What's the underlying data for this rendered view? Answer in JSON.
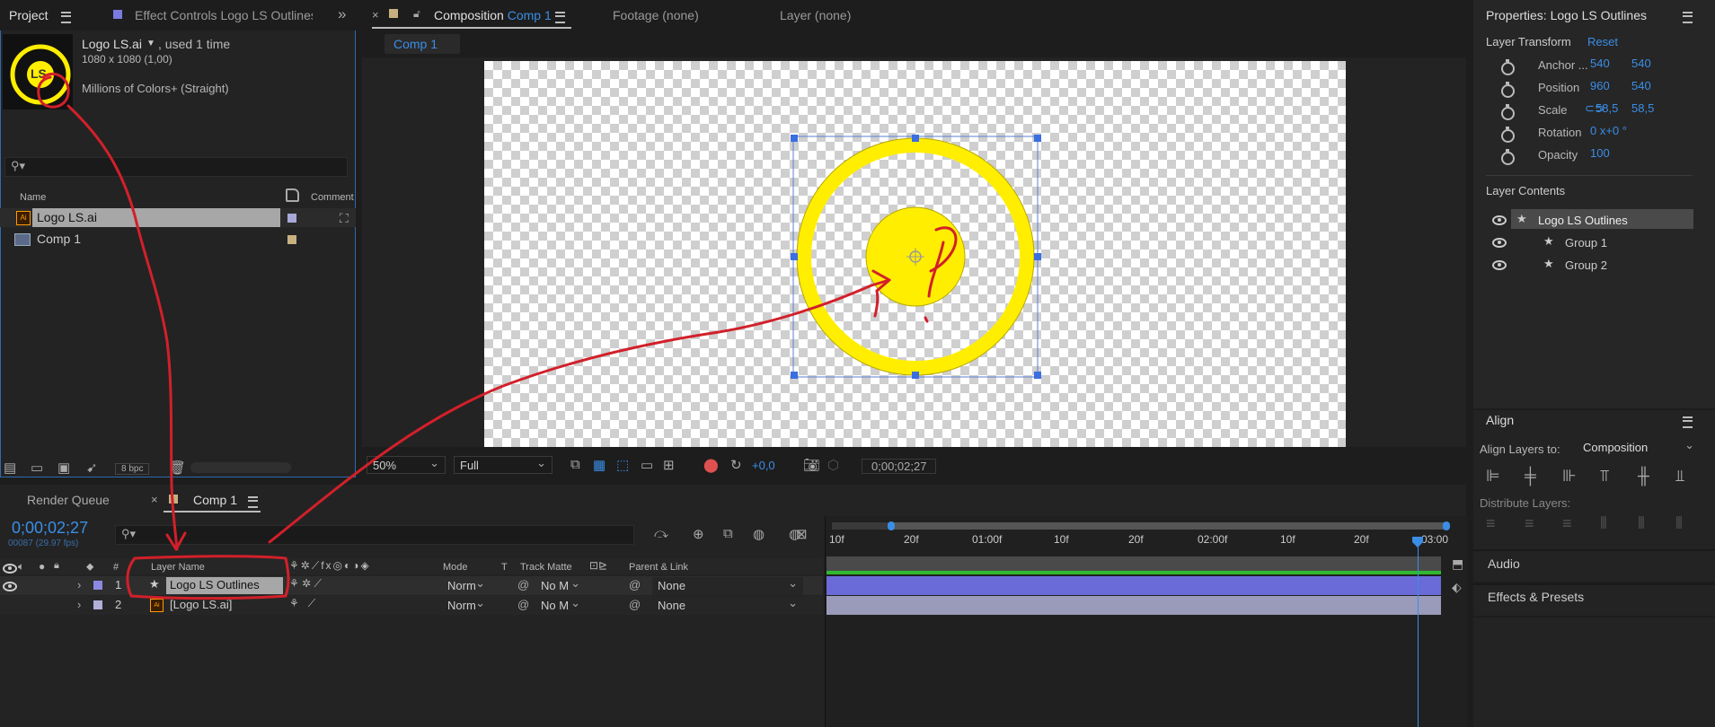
{
  "project_panel": {
    "tab_project": "Project",
    "tab_effect_controls": "Effect Controls Logo LS Outlines",
    "item_name": "Logo LS.ai",
    "item_used": ", used 1 time",
    "item_dims": "1080 x 1080 (1,00)",
    "item_colors": "Millions of Colors+ (Straight)",
    "thumb_text": "LS",
    "col_name": "Name",
    "col_comment": "Comment",
    "items": [
      {
        "label": "Logo LS.ai",
        "color": "#a8a8d8"
      },
      {
        "label": "Comp 1",
        "color": "#c8b080"
      }
    ],
    "bpc": "8 bpc"
  },
  "viewer": {
    "tab_composition_prefix": "Composition",
    "tab_composition_name": "Comp 1",
    "tab_footage": "Footage  (none)",
    "tab_layer": "Layer  (none)",
    "subtab": "Comp 1",
    "zoom": "50%",
    "resolution": "Full",
    "exposure": "+0,0",
    "timecode": "0;00;02;27"
  },
  "properties": {
    "title": "Properties: Logo LS Outlines",
    "layer_transform": "Layer Transform",
    "reset": "Reset",
    "rows": [
      {
        "label": "Anchor ...",
        "v1": "540",
        "v2": "540"
      },
      {
        "label": "Position",
        "v1": "960",
        "v2": "540"
      },
      {
        "label": "Scale",
        "v1": "58,5",
        "v2": "58,5"
      },
      {
        "label": "Rotation",
        "v1": "0 x+0 °",
        "v2": ""
      },
      {
        "label": "Opacity",
        "v1": "100",
        "v2": ""
      }
    ],
    "layer_contents": "Layer Contents",
    "contents": [
      {
        "label": "Logo LS Outlines"
      },
      {
        "label": "Group 1"
      },
      {
        "label": "Group 2"
      }
    ]
  },
  "align": {
    "title": "Align",
    "align_layers_to": "Align Layers to:",
    "align_target": "Composition",
    "distribute_layers": "Distribute Layers:",
    "audio": "Audio",
    "effects_presets": "Effects & Presets"
  },
  "timeline": {
    "tab_render_queue": "Render Queue",
    "tab_comp": "Comp 1",
    "timecode": "0;00;02;27",
    "fps": "00087 (29.97 fps)",
    "col_num": "#",
    "col_layer_name": "Layer Name",
    "col_mode": "Mode",
    "col_t": "T",
    "col_track_matte": "Track Matte",
    "col_parent": "Parent & Link",
    "layers": [
      {
        "num": "1",
        "name": "Logo LS Outlines",
        "mode": "Norm",
        "matte": "No M",
        "parent": "None",
        "color": "#8a8ae0"
      },
      {
        "num": "2",
        "name": "[Logo LS.ai]",
        "mode": "Norm",
        "matte": "No M",
        "parent": "None",
        "color": "#b0b0d8"
      }
    ],
    "ruler": [
      "10f",
      "20f",
      "01:00f",
      "10f",
      "20f",
      "02:00f",
      "10f",
      "20f",
      "03:00"
    ]
  },
  "colors": {
    "accent": "#3a8ee6",
    "logo_yellow": "#ffee00",
    "annotation_red": "#d2202a",
    "layer_bar": "#6a6ad8"
  }
}
